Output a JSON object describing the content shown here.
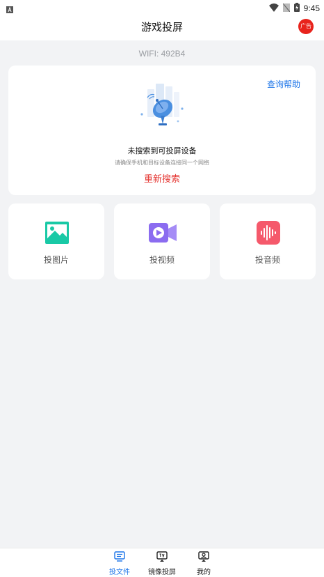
{
  "status_bar": {
    "time": "9:45",
    "icons": [
      "app-notification-icon",
      "wifi-icon",
      "no-sim-icon",
      "battery-charging-icon"
    ]
  },
  "header": {
    "title": "游戏投屏",
    "ad_badge": "广告"
  },
  "wifi": {
    "label": "WIFI: 492B4"
  },
  "search_card": {
    "help_link": "查询帮助",
    "illustration": "satellite-dish-icon",
    "status_title": "未搜索到可投屏设备",
    "status_hint": "请确保手机和目标设备连接同一个网络",
    "retry_label": "重新搜索"
  },
  "features": [
    {
      "label": "投图片",
      "icon": "image-icon",
      "color": "#19c9a6"
    },
    {
      "label": "投视频",
      "icon": "video-icon",
      "color": "#8b6cf0"
    },
    {
      "label": "投音频",
      "icon": "audio-icon",
      "color": "#f5596b"
    }
  ],
  "bottom_nav": {
    "items": [
      {
        "label": "投文件",
        "icon": "file-cast-icon",
        "active": true
      },
      {
        "label": "镜像投屏",
        "icon": "tv-mirror-icon",
        "active": false
      },
      {
        "label": "我的",
        "icon": "profile-icon",
        "active": false
      }
    ]
  },
  "colors": {
    "accent": "#1a73e8",
    "retry": "#e53935",
    "ad_badge": "#e8231c",
    "background": "#f2f3f5"
  }
}
